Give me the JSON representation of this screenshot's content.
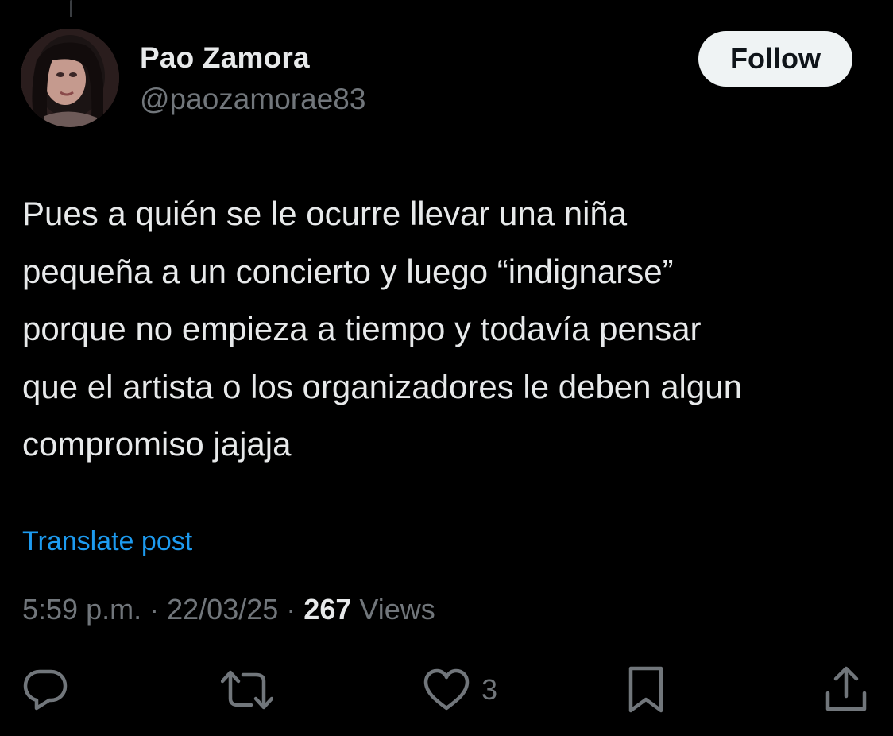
{
  "author": {
    "display_name": "Pao Zamora",
    "handle": "@paozamorae83",
    "follow_label": "Follow"
  },
  "post": {
    "text": "Pues a quién se le ocurre llevar una niña\npequeña a un concierto y luego “indignarse”\nporque no empieza a tiempo y todavía pensar\nque el artista o los organizadores le deben algun\ncompromiso jajaja",
    "translate_label": "Translate post",
    "time": "5:59 p.m.",
    "date": "22/03/25",
    "separator": "·",
    "views_count": "267",
    "views_label": "Views"
  },
  "actions": {
    "reply_icon": "reply-icon",
    "repost_icon": "repost-icon",
    "like_icon": "heart-icon",
    "like_count": "3",
    "bookmark_icon": "bookmark-icon",
    "share_icon": "share-icon"
  },
  "colors": {
    "background": "#000000",
    "text_primary": "#e7e9ea",
    "text_secondary": "#71767b",
    "link": "#1d9bf0",
    "follow_bg": "#eff3f4"
  }
}
